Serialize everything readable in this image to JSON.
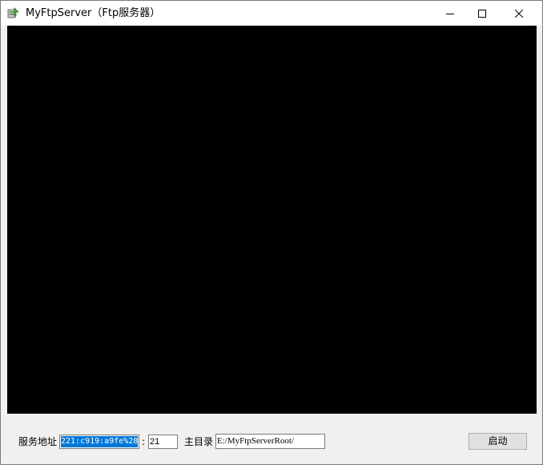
{
  "window": {
    "title": "MyFtpServer（Ftp服务器）"
  },
  "titlebar_buttons": {
    "minimize_icon": "minimize-icon",
    "maximize_icon": "maximize-icon",
    "close_icon": "close-icon"
  },
  "console": {
    "background": "#000000",
    "text": ""
  },
  "form": {
    "address_label": "服务地址",
    "address_value": "221:c919:a9fe%28",
    "port_separator": ":",
    "port_value": "21",
    "root_label": "主目录",
    "root_value": "E:/MyFtpServerRoot/",
    "start_button": "启动"
  },
  "colors": {
    "selection": "#0078d7",
    "window_bg": "#f0f0f0",
    "button_bg": "#e1e1e1"
  }
}
